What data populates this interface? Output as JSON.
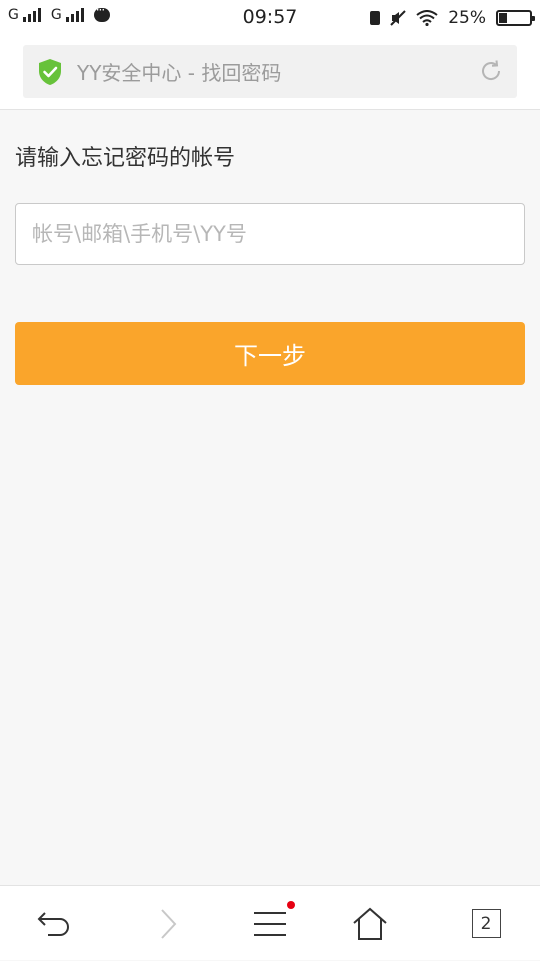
{
  "status_bar": {
    "carrier1": "G",
    "carrier2": "G",
    "time": "09:57",
    "battery_percent": "25%",
    "icons": [
      "signal-icon",
      "signal-icon",
      "chat-icon",
      "battery-saver-icon",
      "mute-icon",
      "wifi-icon",
      "battery-icon"
    ]
  },
  "address_bar": {
    "title": "YY安全中心 - 找回密码",
    "icons": [
      "shield-check-icon",
      "refresh-icon"
    ],
    "shield_color": "#67c23a"
  },
  "form": {
    "label": "请输入忘记密码的帐号",
    "account_placeholder": "帐号\\邮箱\\手机号\\YY号",
    "account_value": "",
    "next_button": "下一步",
    "button_color": "#faa52b"
  },
  "toolbar": {
    "items": [
      "back-icon",
      "forward-icon",
      "menu-icon",
      "home-icon",
      "tabs-icon"
    ],
    "tab_count": "2",
    "menu_badge_color": "#e60012"
  }
}
